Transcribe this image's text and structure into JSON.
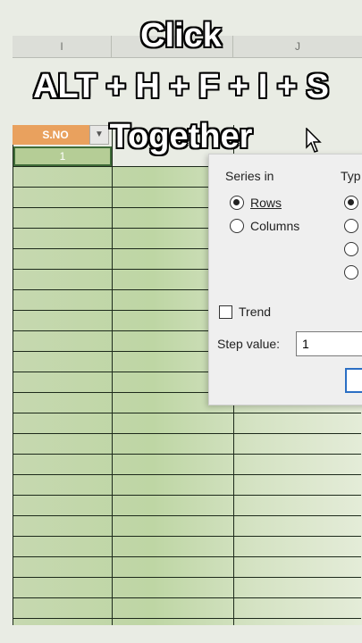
{
  "columns": {
    "col_i": "I",
    "col_j": "J"
  },
  "table": {
    "header": "S.NO",
    "first_value": "1"
  },
  "dialog": {
    "series_in_label": "Series in",
    "rows_label": "Rows",
    "columns_label": "Columns",
    "type_label": "Typ",
    "trend_label": "Trend",
    "step_value_label": "Step value:",
    "step_value": "1"
  },
  "overlay": {
    "line1": "Click",
    "line2": "ALT + H + F + I + S",
    "line3": "Together"
  },
  "colors": {
    "header_orange": "#e9a15e",
    "cell_green": "#c6d8b0",
    "focus_blue": "#2b6fc4"
  }
}
